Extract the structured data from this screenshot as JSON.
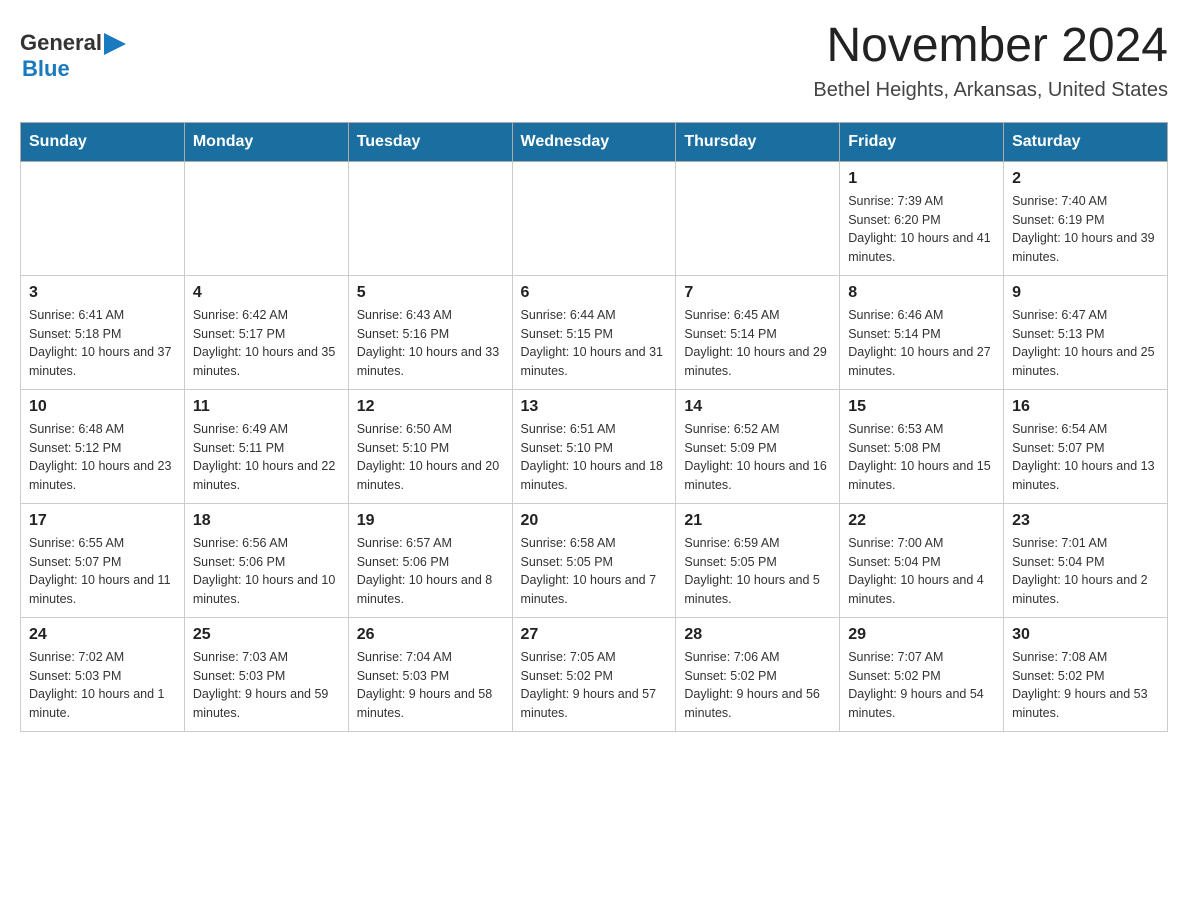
{
  "logo": {
    "text_general": "General",
    "arrow_icon": "▶",
    "text_blue": "Blue"
  },
  "title": {
    "month_year": "November 2024",
    "location": "Bethel Heights, Arkansas, United States"
  },
  "days_of_week": [
    "Sunday",
    "Monday",
    "Tuesday",
    "Wednesday",
    "Thursday",
    "Friday",
    "Saturday"
  ],
  "weeks": [
    {
      "days": [
        {
          "number": "",
          "info": ""
        },
        {
          "number": "",
          "info": ""
        },
        {
          "number": "",
          "info": ""
        },
        {
          "number": "",
          "info": ""
        },
        {
          "number": "",
          "info": ""
        },
        {
          "number": "1",
          "info": "Sunrise: 7:39 AM\nSunset: 6:20 PM\nDaylight: 10 hours and 41 minutes."
        },
        {
          "number": "2",
          "info": "Sunrise: 7:40 AM\nSunset: 6:19 PM\nDaylight: 10 hours and 39 minutes."
        }
      ]
    },
    {
      "days": [
        {
          "number": "3",
          "info": "Sunrise: 6:41 AM\nSunset: 5:18 PM\nDaylight: 10 hours and 37 minutes."
        },
        {
          "number": "4",
          "info": "Sunrise: 6:42 AM\nSunset: 5:17 PM\nDaylight: 10 hours and 35 minutes."
        },
        {
          "number": "5",
          "info": "Sunrise: 6:43 AM\nSunset: 5:16 PM\nDaylight: 10 hours and 33 minutes."
        },
        {
          "number": "6",
          "info": "Sunrise: 6:44 AM\nSunset: 5:15 PM\nDaylight: 10 hours and 31 minutes."
        },
        {
          "number": "7",
          "info": "Sunrise: 6:45 AM\nSunset: 5:14 PM\nDaylight: 10 hours and 29 minutes."
        },
        {
          "number": "8",
          "info": "Sunrise: 6:46 AM\nSunset: 5:14 PM\nDaylight: 10 hours and 27 minutes."
        },
        {
          "number": "9",
          "info": "Sunrise: 6:47 AM\nSunset: 5:13 PM\nDaylight: 10 hours and 25 minutes."
        }
      ]
    },
    {
      "days": [
        {
          "number": "10",
          "info": "Sunrise: 6:48 AM\nSunset: 5:12 PM\nDaylight: 10 hours and 23 minutes."
        },
        {
          "number": "11",
          "info": "Sunrise: 6:49 AM\nSunset: 5:11 PM\nDaylight: 10 hours and 22 minutes."
        },
        {
          "number": "12",
          "info": "Sunrise: 6:50 AM\nSunset: 5:10 PM\nDaylight: 10 hours and 20 minutes."
        },
        {
          "number": "13",
          "info": "Sunrise: 6:51 AM\nSunset: 5:10 PM\nDaylight: 10 hours and 18 minutes."
        },
        {
          "number": "14",
          "info": "Sunrise: 6:52 AM\nSunset: 5:09 PM\nDaylight: 10 hours and 16 minutes."
        },
        {
          "number": "15",
          "info": "Sunrise: 6:53 AM\nSunset: 5:08 PM\nDaylight: 10 hours and 15 minutes."
        },
        {
          "number": "16",
          "info": "Sunrise: 6:54 AM\nSunset: 5:07 PM\nDaylight: 10 hours and 13 minutes."
        }
      ]
    },
    {
      "days": [
        {
          "number": "17",
          "info": "Sunrise: 6:55 AM\nSunset: 5:07 PM\nDaylight: 10 hours and 11 minutes."
        },
        {
          "number": "18",
          "info": "Sunrise: 6:56 AM\nSunset: 5:06 PM\nDaylight: 10 hours and 10 minutes."
        },
        {
          "number": "19",
          "info": "Sunrise: 6:57 AM\nSunset: 5:06 PM\nDaylight: 10 hours and 8 minutes."
        },
        {
          "number": "20",
          "info": "Sunrise: 6:58 AM\nSunset: 5:05 PM\nDaylight: 10 hours and 7 minutes."
        },
        {
          "number": "21",
          "info": "Sunrise: 6:59 AM\nSunset: 5:05 PM\nDaylight: 10 hours and 5 minutes."
        },
        {
          "number": "22",
          "info": "Sunrise: 7:00 AM\nSunset: 5:04 PM\nDaylight: 10 hours and 4 minutes."
        },
        {
          "number": "23",
          "info": "Sunrise: 7:01 AM\nSunset: 5:04 PM\nDaylight: 10 hours and 2 minutes."
        }
      ]
    },
    {
      "days": [
        {
          "number": "24",
          "info": "Sunrise: 7:02 AM\nSunset: 5:03 PM\nDaylight: 10 hours and 1 minute."
        },
        {
          "number": "25",
          "info": "Sunrise: 7:03 AM\nSunset: 5:03 PM\nDaylight: 9 hours and 59 minutes."
        },
        {
          "number": "26",
          "info": "Sunrise: 7:04 AM\nSunset: 5:03 PM\nDaylight: 9 hours and 58 minutes."
        },
        {
          "number": "27",
          "info": "Sunrise: 7:05 AM\nSunset: 5:02 PM\nDaylight: 9 hours and 57 minutes."
        },
        {
          "number": "28",
          "info": "Sunrise: 7:06 AM\nSunset: 5:02 PM\nDaylight: 9 hours and 56 minutes."
        },
        {
          "number": "29",
          "info": "Sunrise: 7:07 AM\nSunset: 5:02 PM\nDaylight: 9 hours and 54 minutes."
        },
        {
          "number": "30",
          "info": "Sunrise: 7:08 AM\nSunset: 5:02 PM\nDaylight: 9 hours and 53 minutes."
        }
      ]
    }
  ]
}
